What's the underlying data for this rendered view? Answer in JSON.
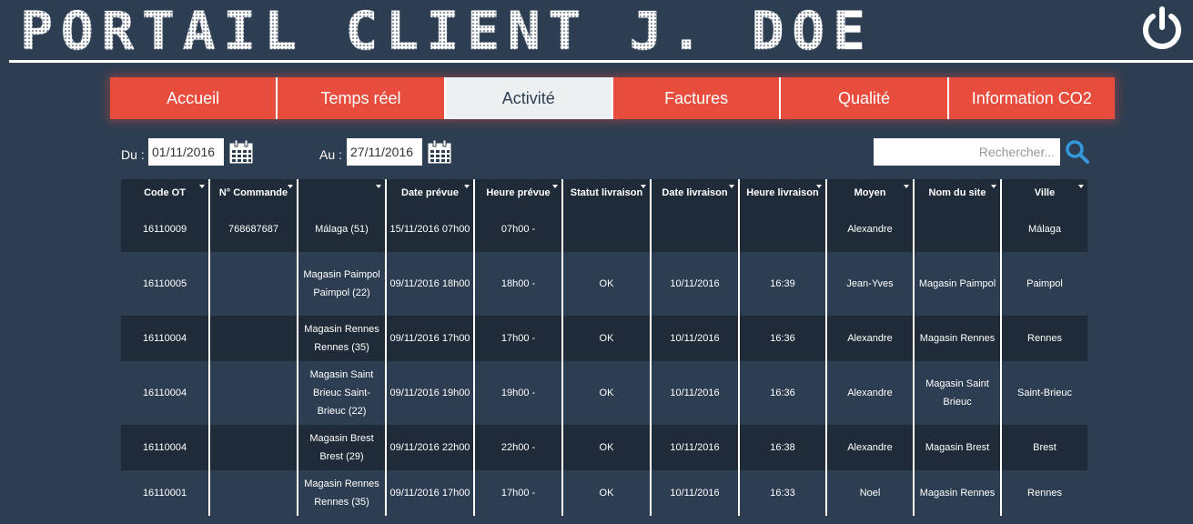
{
  "header": {
    "title": "PORTAIL CLIENT J. DOE",
    "power_icon": "power-icon"
  },
  "nav": {
    "tabs": [
      "Accueil",
      "Temps réel",
      "Activité",
      "Factures",
      "Qualité",
      "Information CO2"
    ],
    "active": "Activité"
  },
  "filters": {
    "from_label": "Du :",
    "from_value": "01/11/2016",
    "to_label": "Au :",
    "to_value": "27/11/2016",
    "search_placeholder": "Rechercher...",
    "calendar_icon": "calendar-icon",
    "search_icon": "search-icon"
  },
  "table": {
    "columns": [
      "Code OT",
      "N° Commande",
      "",
      "Date prévue",
      "Heure prévue",
      "Statut livraison",
      "Date livraison",
      "Heure livraison",
      "Moyen",
      "Nom du site",
      "Ville"
    ],
    "rows": [
      [
        "16110009",
        "768687687",
        "Málaga (51)",
        "15/11/2016 07h00",
        "07h00 -",
        "",
        "",
        "",
        "Alexandre",
        "",
        "Málaga"
      ],
      [
        "16110005",
        "",
        "Magasin Paimpol Paimpol (22)",
        "09/11/2016 18h00",
        "18h00 -",
        "OK",
        "10/11/2016",
        "16:39",
        "Jean-Yves",
        "Magasin Paimpol",
        "Paimpol"
      ],
      [
        "16110004",
        "",
        "Magasin Rennes Rennes (35)",
        "09/11/2016 17h00",
        "17h00 -",
        "OK",
        "10/11/2016",
        "16:36",
        "Alexandre",
        "Magasin Rennes",
        "Rennes"
      ],
      [
        "16110004",
        "",
        "Magasin Saint Brieuc Saint-Brieuc (22)",
        "09/11/2016 19h00",
        "19h00 -",
        "OK",
        "10/11/2016",
        "16:36",
        "Alexandre",
        "Magasin Saint Brieuc",
        "Saint-Brieuc"
      ],
      [
        "16110004",
        "",
        "Magasin Brest Brest (29)",
        "09/11/2016 22h00",
        "22h00 -",
        "OK",
        "10/11/2016",
        "16:38",
        "Alexandre",
        "Magasin Brest",
        "Brest"
      ],
      [
        "16110001",
        "",
        "Magasin Rennes Rennes (35)",
        "09/11/2016 17h00",
        "17h00 -",
        "OK",
        "10/11/2016",
        "16:33",
        "Noel",
        "Magasin Rennes",
        "Rennes"
      ]
    ]
  },
  "colors": {
    "background": "#2e3e52",
    "nav_accent": "#e74c3c",
    "nav_active": "#ecf0f1",
    "header_row": "#1f2b38",
    "search_icon": "#3498db"
  }
}
